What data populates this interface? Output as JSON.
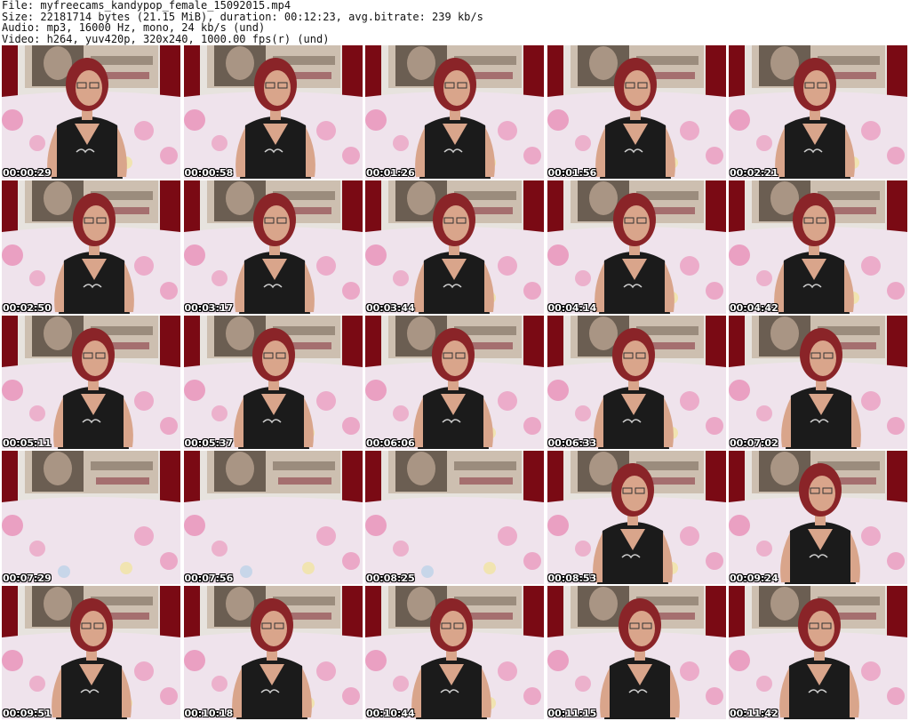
{
  "file_info": {
    "file": "File: myfreecams_kandypop_female_15092015.mp4",
    "size": "Size: 22181714 bytes (21.15 MiB), duration: 00:12:23, avg.bitrate: 239 kb/s",
    "audio": "Audio: mp3, 16000 Hz, mono, 24 kb/s (und)",
    "video": "Video: h264, yuv420p, 320x240, 1000.00 fps(r) (und)"
  },
  "thumbnails": [
    {
      "timestamp": "00:00:29",
      "person": true
    },
    {
      "timestamp": "00:00:58",
      "person": true
    },
    {
      "timestamp": "00:01:26",
      "person": true
    },
    {
      "timestamp": "00:01:56",
      "person": true
    },
    {
      "timestamp": "00:02:21",
      "person": true
    },
    {
      "timestamp": "00:02:50",
      "person": true
    },
    {
      "timestamp": "00:03:17",
      "person": true
    },
    {
      "timestamp": "00:03:44",
      "person": true
    },
    {
      "timestamp": "00:04:14",
      "person": true
    },
    {
      "timestamp": "00:04:42",
      "person": true
    },
    {
      "timestamp": "00:05:11",
      "person": true
    },
    {
      "timestamp": "00:05:37",
      "person": true
    },
    {
      "timestamp": "00:06:06",
      "person": true
    },
    {
      "timestamp": "00:06:33",
      "person": true
    },
    {
      "timestamp": "00:07:02",
      "person": true
    },
    {
      "timestamp": "00:07:29",
      "person": false
    },
    {
      "timestamp": "00:07:56",
      "person": false
    },
    {
      "timestamp": "00:08:25",
      "person": false
    },
    {
      "timestamp": "00:08:53",
      "person": true
    },
    {
      "timestamp": "00:09:24",
      "person": true
    },
    {
      "timestamp": "00:09:51",
      "person": true
    },
    {
      "timestamp": "00:10:18",
      "person": true
    },
    {
      "timestamp": "00:10:44",
      "person": true
    },
    {
      "timestamp": "00:11:15",
      "person": true
    },
    {
      "timestamp": "00:11:42",
      "person": true
    }
  ],
  "colors": {
    "background": "#ffffff",
    "header_text": "#111111",
    "timestamp_text": "#ffffff",
    "curtain": "#7a0a14",
    "wall": "#e7e3de",
    "poster": "#6b5e52",
    "couch": "#efe3ec",
    "rose": "#e98fb8",
    "skin": "#d9a58b",
    "hair": "#8a2428",
    "top": "#1b1b1b"
  }
}
